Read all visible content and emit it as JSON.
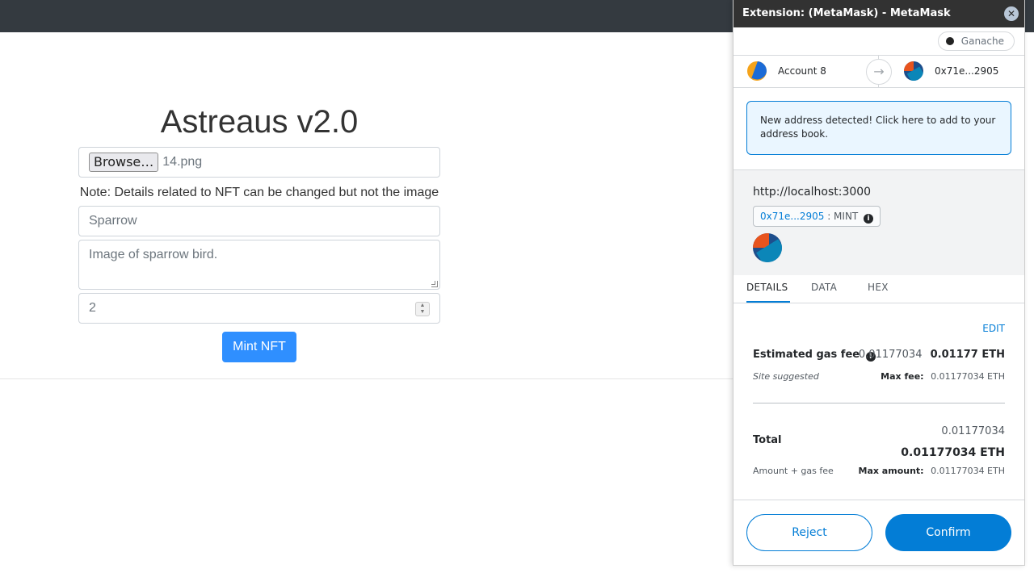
{
  "app": {
    "title": "Astreaus v2.0",
    "browse_label": "Browse…",
    "file_name": "14.png",
    "note": "Note: Details related to NFT can be changed but not the image",
    "name_value": "Sparrow",
    "description_value": "Image of sparrow bird.",
    "quantity_value": "2",
    "mint_label": "Mint NFT"
  },
  "popup": {
    "window_title": "Extension: (MetaMask) - MetaMask Notificatio…",
    "close_glyph": "✕",
    "network": "Ganache",
    "from_account": "Account 8",
    "to_account": "0x71e...2905",
    "arrow_glyph": "→",
    "notice": "New address detected! Click here to add to your address book.",
    "origin": "http://localhost:3000",
    "method_address": "0x71e...2905",
    "method_name": ": MINT",
    "tabs": [
      "DETAILS",
      "DATA",
      "HEX"
    ],
    "edit_label": "EDIT",
    "gas": {
      "label": "Estimated gas fee",
      "info_glyph": "i",
      "fiat_like": "0.01177034",
      "primary": "0.01177 ETH",
      "site_suggested": "Site suggested",
      "max_fee_label": "Max fee:",
      "max_fee_value": "0.01177034 ETH"
    },
    "total": {
      "amount": "0.01177034",
      "label": "Total",
      "eth": "0.01177034 ETH",
      "sub_label": "Amount + gas fee",
      "max_amount_label": "Max amount:",
      "max_amount_value": "0.01177034 ETH"
    },
    "reject_label": "Reject",
    "confirm_label": "Confirm"
  },
  "colors": {
    "metamask_blue": "#037dd6",
    "bootstrap_primary": "#2f8fff",
    "topbar": "#343a40"
  }
}
